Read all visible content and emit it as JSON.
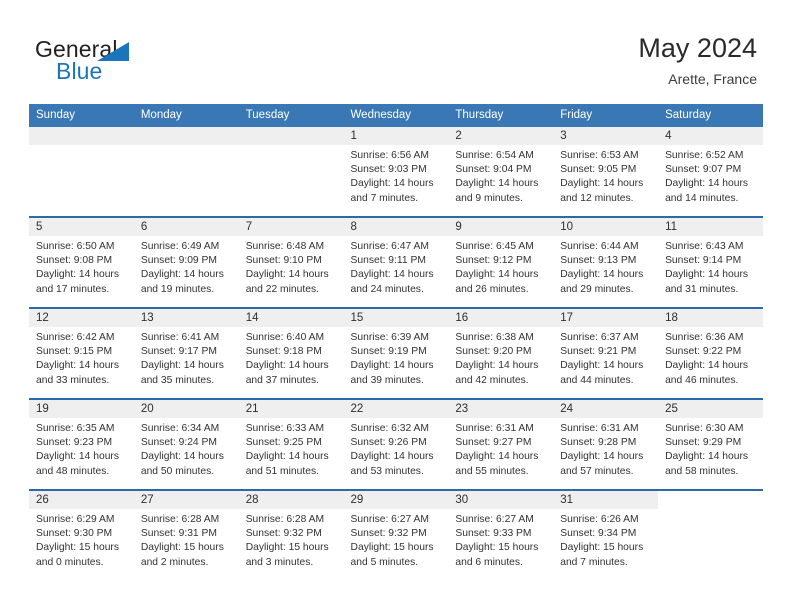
{
  "brand": {
    "name_part1": "General",
    "name_part2": "Blue",
    "logo_icon": "triangle-logo-icon"
  },
  "header": {
    "title": "May 2024",
    "subtitle": "Arette, France"
  },
  "colors": {
    "header_blue": "#3a78b5",
    "row_divider_blue": "#2b6aa8",
    "daynum_band": "#efefef",
    "brand_blue": "#1b75bb"
  },
  "weekdays": [
    "Sunday",
    "Monday",
    "Tuesday",
    "Wednesday",
    "Thursday",
    "Friday",
    "Saturday"
  ],
  "weeks": [
    [
      {
        "day": "",
        "empty": true
      },
      {
        "day": "",
        "empty": true
      },
      {
        "day": "",
        "empty": true
      },
      {
        "day": "1",
        "sunrise": "Sunrise: 6:56 AM",
        "sunset": "Sunset: 9:03 PM",
        "daylight_line1": "Daylight: 14 hours",
        "daylight_line2": "and 7 minutes."
      },
      {
        "day": "2",
        "sunrise": "Sunrise: 6:54 AM",
        "sunset": "Sunset: 9:04 PM",
        "daylight_line1": "Daylight: 14 hours",
        "daylight_line2": "and 9 minutes."
      },
      {
        "day": "3",
        "sunrise": "Sunrise: 6:53 AM",
        "sunset": "Sunset: 9:05 PM",
        "daylight_line1": "Daylight: 14 hours",
        "daylight_line2": "and 12 minutes."
      },
      {
        "day": "4",
        "sunrise": "Sunrise: 6:52 AM",
        "sunset": "Sunset: 9:07 PM",
        "daylight_line1": "Daylight: 14 hours",
        "daylight_line2": "and 14 minutes."
      }
    ],
    [
      {
        "day": "5",
        "sunrise": "Sunrise: 6:50 AM",
        "sunset": "Sunset: 9:08 PM",
        "daylight_line1": "Daylight: 14 hours",
        "daylight_line2": "and 17 minutes."
      },
      {
        "day": "6",
        "sunrise": "Sunrise: 6:49 AM",
        "sunset": "Sunset: 9:09 PM",
        "daylight_line1": "Daylight: 14 hours",
        "daylight_line2": "and 19 minutes."
      },
      {
        "day": "7",
        "sunrise": "Sunrise: 6:48 AM",
        "sunset": "Sunset: 9:10 PM",
        "daylight_line1": "Daylight: 14 hours",
        "daylight_line2": "and 22 minutes."
      },
      {
        "day": "8",
        "sunrise": "Sunrise: 6:47 AM",
        "sunset": "Sunset: 9:11 PM",
        "daylight_line1": "Daylight: 14 hours",
        "daylight_line2": "and 24 minutes."
      },
      {
        "day": "9",
        "sunrise": "Sunrise: 6:45 AM",
        "sunset": "Sunset: 9:12 PM",
        "daylight_line1": "Daylight: 14 hours",
        "daylight_line2": "and 26 minutes."
      },
      {
        "day": "10",
        "sunrise": "Sunrise: 6:44 AM",
        "sunset": "Sunset: 9:13 PM",
        "daylight_line1": "Daylight: 14 hours",
        "daylight_line2": "and 29 minutes."
      },
      {
        "day": "11",
        "sunrise": "Sunrise: 6:43 AM",
        "sunset": "Sunset: 9:14 PM",
        "daylight_line1": "Daylight: 14 hours",
        "daylight_line2": "and 31 minutes."
      }
    ],
    [
      {
        "day": "12",
        "sunrise": "Sunrise: 6:42 AM",
        "sunset": "Sunset: 9:15 PM",
        "daylight_line1": "Daylight: 14 hours",
        "daylight_line2": "and 33 minutes."
      },
      {
        "day": "13",
        "sunrise": "Sunrise: 6:41 AM",
        "sunset": "Sunset: 9:17 PM",
        "daylight_line1": "Daylight: 14 hours",
        "daylight_line2": "and 35 minutes."
      },
      {
        "day": "14",
        "sunrise": "Sunrise: 6:40 AM",
        "sunset": "Sunset: 9:18 PM",
        "daylight_line1": "Daylight: 14 hours",
        "daylight_line2": "and 37 minutes."
      },
      {
        "day": "15",
        "sunrise": "Sunrise: 6:39 AM",
        "sunset": "Sunset: 9:19 PM",
        "daylight_line1": "Daylight: 14 hours",
        "daylight_line2": "and 39 minutes."
      },
      {
        "day": "16",
        "sunrise": "Sunrise: 6:38 AM",
        "sunset": "Sunset: 9:20 PM",
        "daylight_line1": "Daylight: 14 hours",
        "daylight_line2": "and 42 minutes."
      },
      {
        "day": "17",
        "sunrise": "Sunrise: 6:37 AM",
        "sunset": "Sunset: 9:21 PM",
        "daylight_line1": "Daylight: 14 hours",
        "daylight_line2": "and 44 minutes."
      },
      {
        "day": "18",
        "sunrise": "Sunrise: 6:36 AM",
        "sunset": "Sunset: 9:22 PM",
        "daylight_line1": "Daylight: 14 hours",
        "daylight_line2": "and 46 minutes."
      }
    ],
    [
      {
        "day": "19",
        "sunrise": "Sunrise: 6:35 AM",
        "sunset": "Sunset: 9:23 PM",
        "daylight_line1": "Daylight: 14 hours",
        "daylight_line2": "and 48 minutes."
      },
      {
        "day": "20",
        "sunrise": "Sunrise: 6:34 AM",
        "sunset": "Sunset: 9:24 PM",
        "daylight_line1": "Daylight: 14 hours",
        "daylight_line2": "and 50 minutes."
      },
      {
        "day": "21",
        "sunrise": "Sunrise: 6:33 AM",
        "sunset": "Sunset: 9:25 PM",
        "daylight_line1": "Daylight: 14 hours",
        "daylight_line2": "and 51 minutes."
      },
      {
        "day": "22",
        "sunrise": "Sunrise: 6:32 AM",
        "sunset": "Sunset: 9:26 PM",
        "daylight_line1": "Daylight: 14 hours",
        "daylight_line2": "and 53 minutes."
      },
      {
        "day": "23",
        "sunrise": "Sunrise: 6:31 AM",
        "sunset": "Sunset: 9:27 PM",
        "daylight_line1": "Daylight: 14 hours",
        "daylight_line2": "and 55 minutes."
      },
      {
        "day": "24",
        "sunrise": "Sunrise: 6:31 AM",
        "sunset": "Sunset: 9:28 PM",
        "daylight_line1": "Daylight: 14 hours",
        "daylight_line2": "and 57 minutes."
      },
      {
        "day": "25",
        "sunrise": "Sunrise: 6:30 AM",
        "sunset": "Sunset: 9:29 PM",
        "daylight_line1": "Daylight: 14 hours",
        "daylight_line2": "and 58 minutes."
      }
    ],
    [
      {
        "day": "26",
        "sunrise": "Sunrise: 6:29 AM",
        "sunset": "Sunset: 9:30 PM",
        "daylight_line1": "Daylight: 15 hours",
        "daylight_line2": "and 0 minutes."
      },
      {
        "day": "27",
        "sunrise": "Sunrise: 6:28 AM",
        "sunset": "Sunset: 9:31 PM",
        "daylight_line1": "Daylight: 15 hours",
        "daylight_line2": "and 2 minutes."
      },
      {
        "day": "28",
        "sunrise": "Sunrise: 6:28 AM",
        "sunset": "Sunset: 9:32 PM",
        "daylight_line1": "Daylight: 15 hours",
        "daylight_line2": "and 3 minutes."
      },
      {
        "day": "29",
        "sunrise": "Sunrise: 6:27 AM",
        "sunset": "Sunset: 9:32 PM",
        "daylight_line1": "Daylight: 15 hours",
        "daylight_line2": "and 5 minutes."
      },
      {
        "day": "30",
        "sunrise": "Sunrise: 6:27 AM",
        "sunset": "Sunset: 9:33 PM",
        "daylight_line1": "Daylight: 15 hours",
        "daylight_line2": "and 6 minutes."
      },
      {
        "day": "31",
        "sunrise": "Sunrise: 6:26 AM",
        "sunset": "Sunset: 9:34 PM",
        "daylight_line1": "Daylight: 15 hours",
        "daylight_line2": "and 7 minutes."
      },
      {
        "day": "",
        "empty": true,
        "blank": true
      }
    ]
  ]
}
